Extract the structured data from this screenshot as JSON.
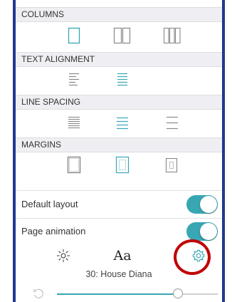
{
  "sections": {
    "columns": "COLUMNS",
    "text_alignment": "TEXT ALIGNMENT",
    "line_spacing": "LINE SPACING",
    "margins": "MARGINS"
  },
  "columns_options": [
    {
      "icon": "single-column-icon",
      "selected": true
    },
    {
      "icon": "two-column-icon",
      "selected": false
    },
    {
      "icon": "three-column-icon",
      "selected": false
    }
  ],
  "alignment_options": [
    {
      "icon": "align-left-icon",
      "selected": false
    },
    {
      "icon": "align-justify-icon",
      "selected": true
    }
  ],
  "spacing_options": [
    {
      "icon": "spacing-narrow-icon",
      "selected": false
    },
    {
      "icon": "spacing-medium-icon",
      "selected": true
    },
    {
      "icon": "spacing-wide-icon",
      "selected": false
    }
  ],
  "margin_options": [
    {
      "icon": "margin-small-icon",
      "selected": false
    },
    {
      "icon": "margin-medium-icon",
      "selected": true
    },
    {
      "icon": "margin-large-icon",
      "selected": false
    }
  ],
  "settings": {
    "default_layout": {
      "label": "Default layout",
      "on": true
    },
    "page_animation": {
      "label": "Page animation",
      "on": true
    }
  },
  "tabs": {
    "brightness_icon": "sun-icon",
    "font_label": "Aa",
    "settings_icon": "gear-icon"
  },
  "chapter_label": "30: House Diana",
  "progress": 0.75,
  "colors": {
    "accent": "#38a7b3",
    "inactive": "#888888",
    "highlight_circle": "#c00000",
    "section_bg": "#efeff3"
  }
}
